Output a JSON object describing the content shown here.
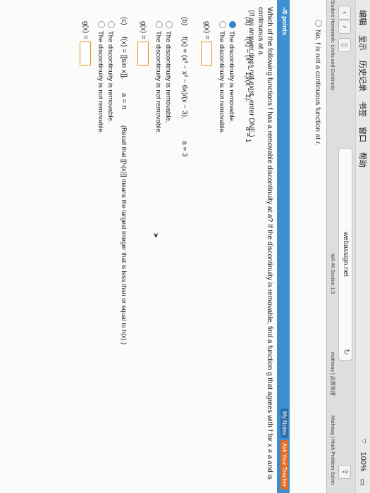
{
  "menubar": {
    "items": [
      "编辑",
      "显示",
      "历史记录",
      "书签",
      "窗口",
      "帮助"
    ],
    "zoom": "100%"
  },
  "browser": {
    "url": "webassign.net",
    "tabs": [
      "Student Homework: Limits and Continuity",
      "WA #8 Section 1.5",
      "mathway | 品質保證",
      "Mathway | Math Problem Solver"
    ]
  },
  "page": {
    "previous_answer": "No, f is not a continuous function at r.",
    "points_label": "-/6 points",
    "my_notes": "My Notes",
    "ask_teacher": "Ask Your Teacher",
    "question_line1": "Which of the following functions f has a removable discontinuity at a? If the discontinuity is removable, find a function g that agrees with f for x ≠ a and is continuous at a.",
    "question_line2": "(If an answer does not exist, enter DNE.)",
    "parts": [
      {
        "label": "(a)",
        "function": "f(x) = (x⁴ − 1)/(x − 1),",
        "a_value": "a = 1",
        "options": [
          "The discontinuity is removable.",
          "The discontinuity is not removable."
        ],
        "selected": 0,
        "g_label": "g(x) ="
      },
      {
        "label": "(b)",
        "function": "f(x) = (x³ − x² − 6x)/(x − 3),",
        "a_value": "a = 3",
        "options": [
          "The discontinuity is removable.",
          "The discontinuity is not removable."
        ],
        "selected": -1,
        "g_label": "g(x) ="
      },
      {
        "label": "(c)",
        "function": "f(x) = [[sin x]],",
        "a_value": "a = π",
        "note": "(Recall that [[h(x)]] means the largest integer that is less than or equal to h(x).)",
        "options": [
          "The discontinuity is removable.",
          "The discontinuity is not removable."
        ],
        "selected": -1,
        "g_label": "g(x) ="
      }
    ]
  }
}
